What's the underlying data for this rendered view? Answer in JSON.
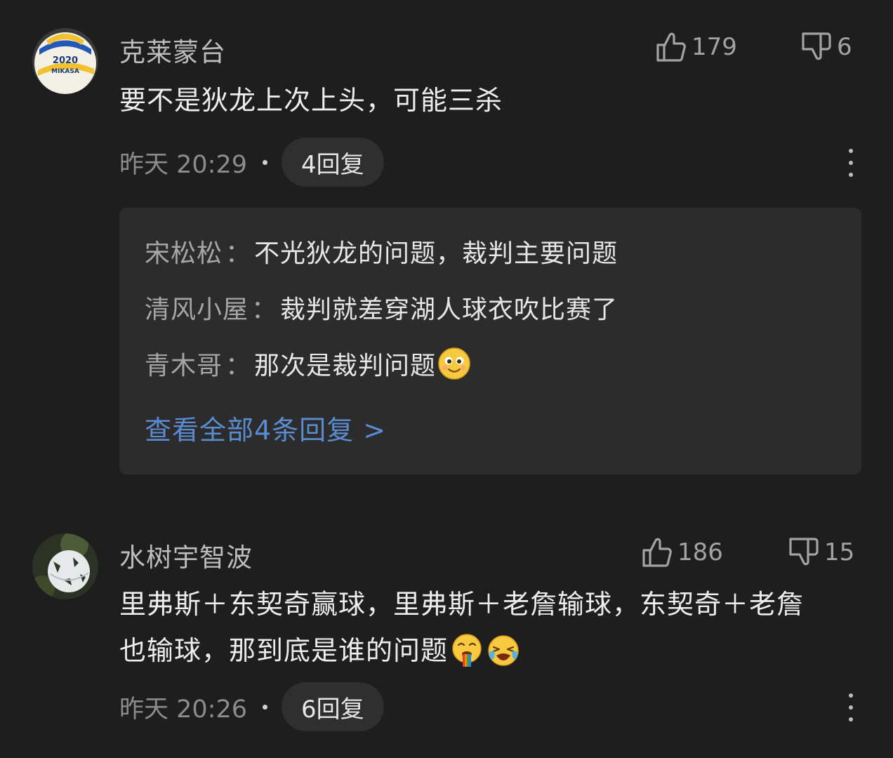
{
  "comments": [
    {
      "username": "克莱蒙台",
      "avatar_icon": "volleyball-avatar",
      "likes": "179",
      "dislikes": "6",
      "text": "要不是狄龙上次上头，可能三杀",
      "time": "昨天 20:29",
      "reply_count_label": "4回复",
      "replies": [
        {
          "name": "宋松松",
          "text": "不光狄龙的问题，裁判主要问题"
        },
        {
          "name": "清风小屋",
          "text": "裁判就差穿湖人球衣吹比赛了"
        },
        {
          "name": "青木哥",
          "text": "那次是裁判问题",
          "emoji": "smile-emoji"
        }
      ],
      "view_all_label": "查看全部4条回复 >"
    },
    {
      "username": "水树宇智波",
      "avatar_icon": "soccer-ball-avatar",
      "likes": "186",
      "dislikes": "15",
      "text_line1": "里弗斯＋东契奇赢球，里弗斯＋老詹输球，东契奇＋老詹",
      "text_line2": "也输球，那到底是谁的问题",
      "text_emojis": [
        "rainbow-vomit-emoji",
        "crying-emoji"
      ],
      "time": "昨天 20:26",
      "reply_count_label": "6回复"
    }
  ],
  "colors": {
    "background": "#1e1e1e",
    "reply_box": "#2c2c2c",
    "link": "#5b8bd0",
    "muted": "#8c8c8c"
  },
  "separator": "："
}
